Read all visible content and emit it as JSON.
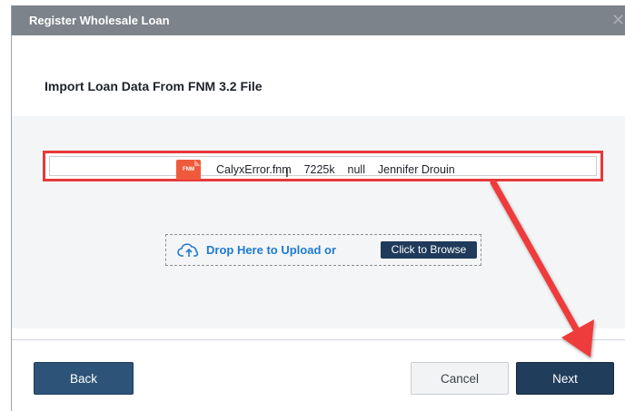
{
  "dialog": {
    "title": "Register Wholesale Loan",
    "close_glyph": "✕",
    "section_title": "Import Loan Data From FNM 3.2 File"
  },
  "file": {
    "icon_label": "FNM",
    "name": "CalyxError.fnm",
    "size": "7225k",
    "status": "null",
    "owner": "Jennifer Drouin"
  },
  "dropzone": {
    "icon": "cloud-upload-icon",
    "text": "Drop Here to Upload or",
    "browse_label": "Click to Browse"
  },
  "buttons": {
    "back": "Back",
    "cancel": "Cancel",
    "next": "Next"
  },
  "colors": {
    "titlebar": "#7d838a",
    "highlight": "#e6393b",
    "primary": "#213d5c",
    "link": "#1f7bd0"
  }
}
